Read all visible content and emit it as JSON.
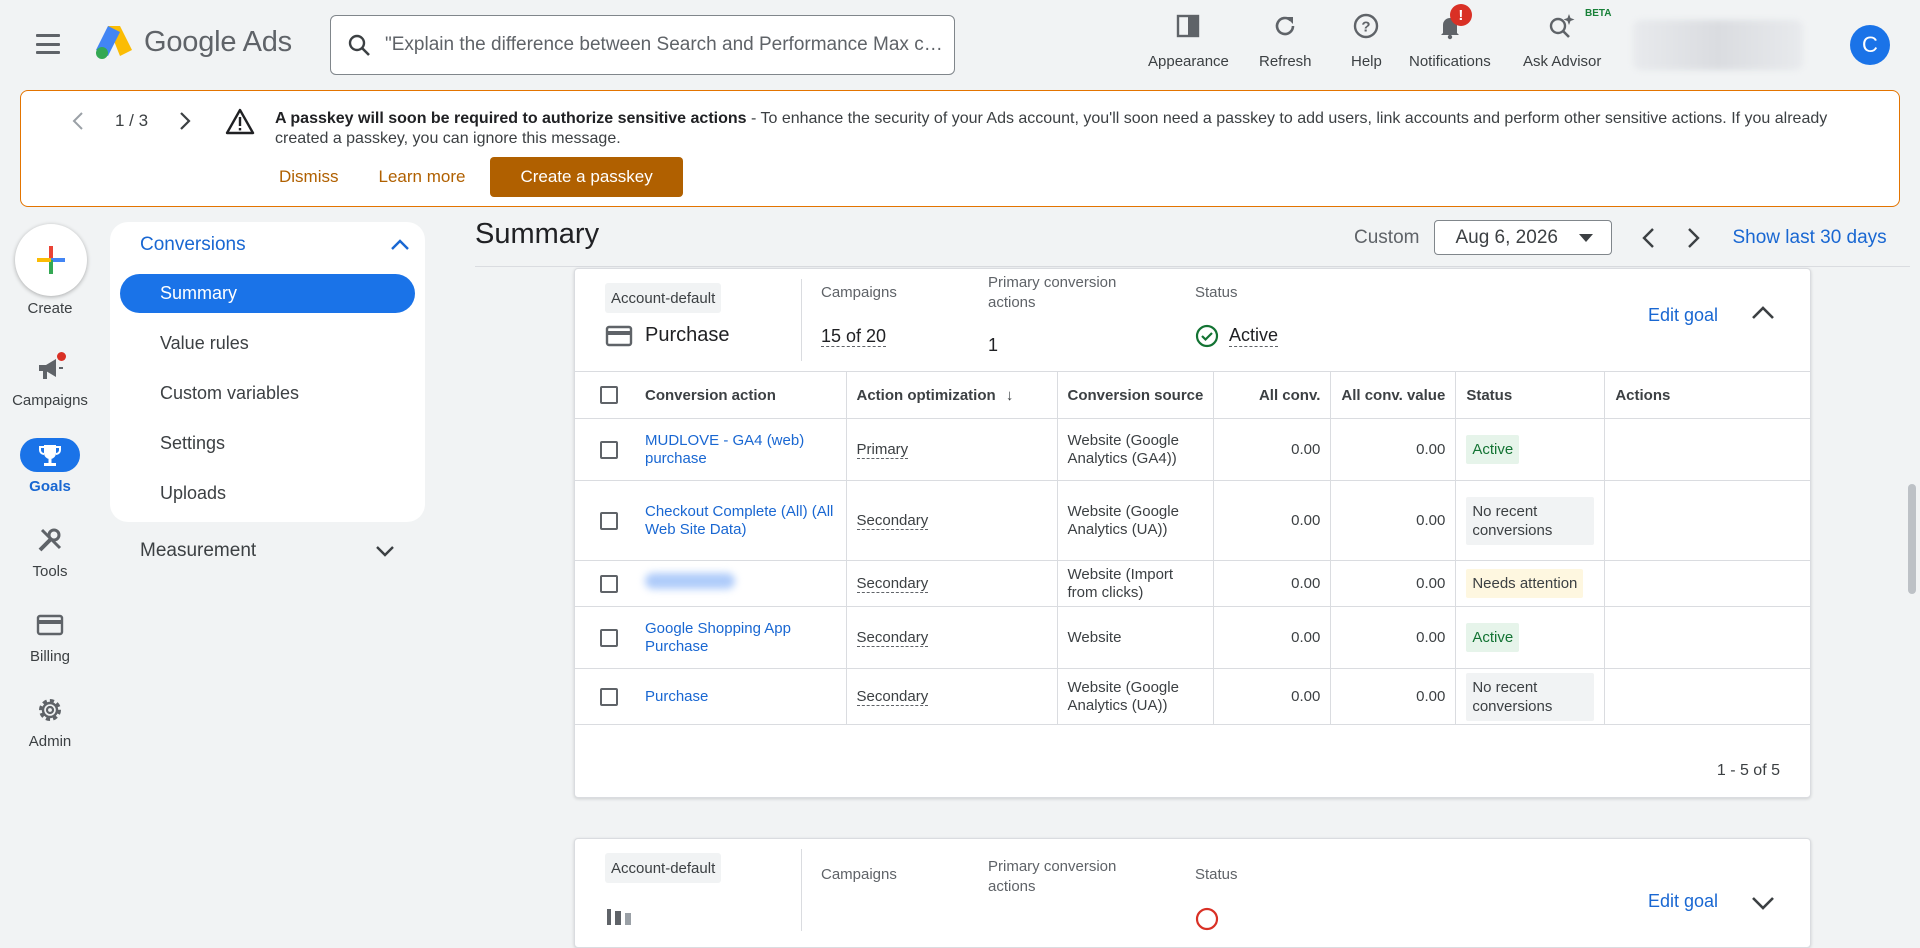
{
  "app": {
    "name": "Google Ads"
  },
  "search": {
    "placeholder": "\"Explain the difference between Search and Performance Max cam..."
  },
  "toolbar": {
    "appearance": "Appearance",
    "refresh": "Refresh",
    "help": "Help",
    "notifications": "Notifications",
    "notifications_badge": "!",
    "ask_advisor": "Ask Advisor",
    "beta": "BETA"
  },
  "user": {
    "initial": "C"
  },
  "banner": {
    "pager": "1 / 3",
    "title": "A passkey will soon be required to authorize sensitive actions",
    "body": " - To enhance the security of your Ads account, you'll soon need a passkey to add users, link accounts and perform other sensitive actions. If you already created a passkey, you can ignore this message.",
    "dismiss": "Dismiss",
    "learn_more": "Learn more",
    "create_passkey": "Create a passkey"
  },
  "nav": {
    "create": "Create",
    "campaigns": "Campaigns",
    "goals": "Goals",
    "tools": "Tools",
    "billing": "Billing",
    "admin": "Admin"
  },
  "subnav": {
    "section": "Conversions",
    "items": [
      "Summary",
      "Value rules",
      "Custom variables",
      "Settings",
      "Uploads"
    ],
    "measurement": "Measurement"
  },
  "page": {
    "title": "Summary",
    "date_mode": "Custom",
    "date": "Aug 6, 2026",
    "show_last": "Show last 30 days"
  },
  "goal1": {
    "chip": "Account-default",
    "name": "Purchase",
    "campaigns_label": "Campaigns",
    "campaigns_value": "15 of 20",
    "primary_label": "Primary conversion actions",
    "primary_value": "1",
    "status_label": "Status",
    "status_value": "Active",
    "edit": "Edit goal",
    "columns": [
      "Conversion action",
      "Action optimization",
      "Conversion source",
      "All conv.",
      "All conv. value",
      "Status",
      "Actions"
    ],
    "rows": [
      {
        "name": "MUDLOVE - GA4 (web) purchase",
        "optimization": "Primary",
        "source": "Website (Google Analytics (GA4))",
        "conv": "0.00",
        "value": "0.00",
        "status": "Active",
        "kind": "active"
      },
      {
        "name": "Checkout Complete (All) (All Web Site Data)",
        "optimization": "Secondary",
        "source": "Website (Google Analytics (UA))",
        "conv": "0.00",
        "value": "0.00",
        "status": "No recent conversions",
        "kind": "none"
      },
      {
        "name": "",
        "optimization": "Secondary",
        "source": "Website (Import from clicks)",
        "conv": "0.00",
        "value": "0.00",
        "status": "Needs attention",
        "kind": "attn"
      },
      {
        "name": "Google Shopping App Purchase",
        "optimization": "Secondary",
        "source": "Website",
        "conv": "0.00",
        "value": "0.00",
        "status": "Active",
        "kind": "active"
      },
      {
        "name": "Purchase",
        "optimization": "Secondary",
        "source": "Website (Google Analytics (UA))",
        "conv": "0.00",
        "value": "0.00",
        "status": "No recent conversions",
        "kind": "none"
      }
    ],
    "pagination": "1 - 5 of 5"
  },
  "goal2": {
    "chip": "Account-default",
    "campaigns_label": "Campaigns",
    "primary_label": "Primary conversion actions",
    "status_label": "Status",
    "edit": "Edit goal"
  },
  "colors": {
    "accent": "#1a73e8",
    "warning": "#b06000",
    "success": "#137333",
    "alert": "#d93025"
  }
}
